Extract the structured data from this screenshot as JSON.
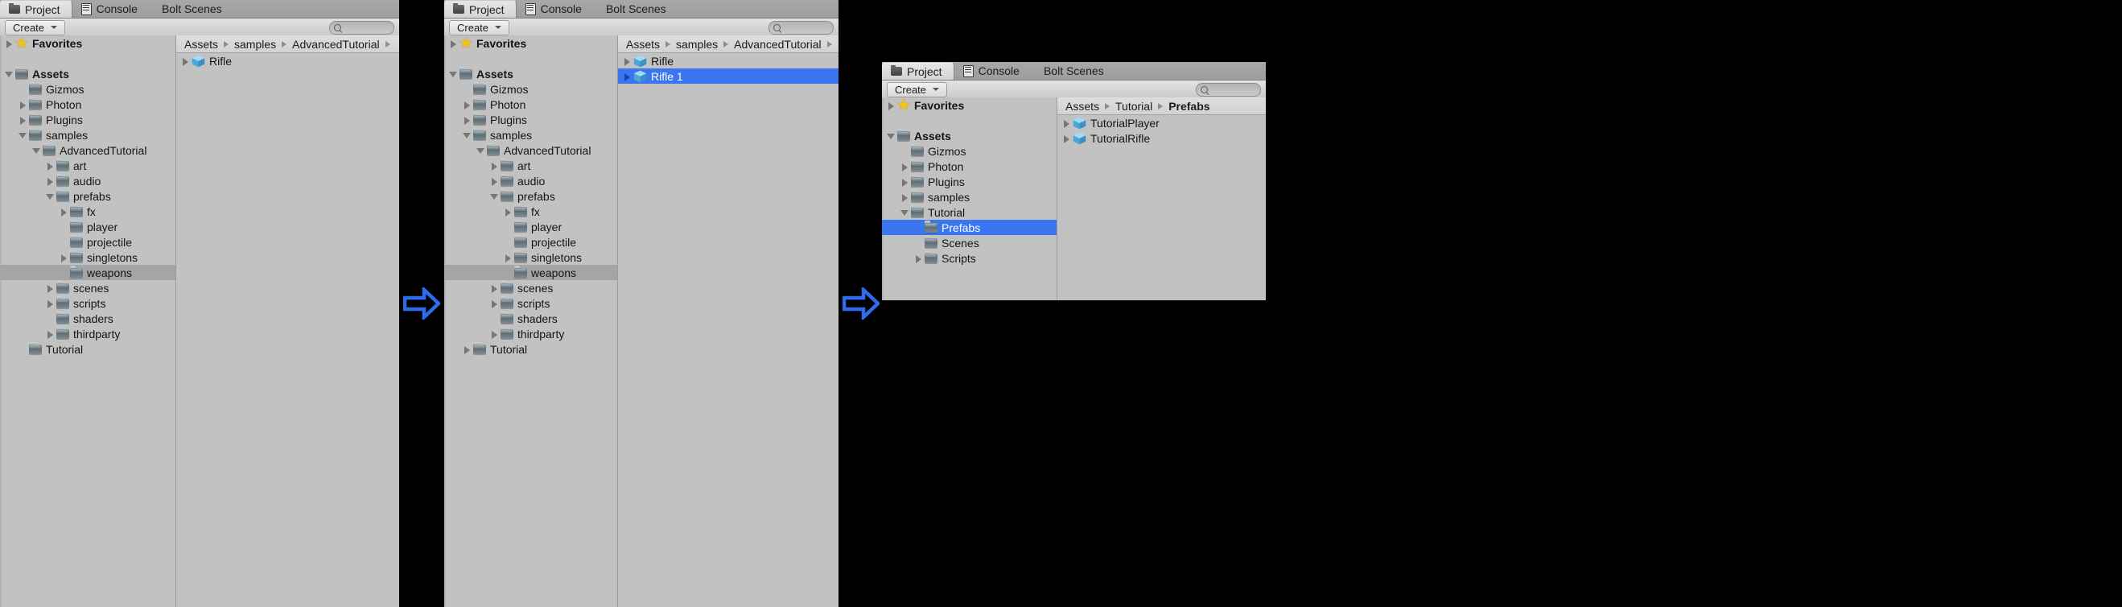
{
  "window": {
    "tabs": [
      {
        "label": "Project",
        "icon": "folder-icon",
        "active": true
      },
      {
        "label": "Console",
        "icon": "console-icon",
        "active": false
      },
      {
        "label": "Bolt Scenes",
        "icon": "",
        "active": false
      }
    ],
    "toolbar": {
      "create_label": "Create",
      "search_placeholder": "",
      "search_value": "",
      "search_icon": "search-icon"
    }
  },
  "panels": [
    {
      "id": "panel-1",
      "breadcrumb": [
        "Assets",
        "samples",
        "AdvancedTutorial",
        ""
      ],
      "tree": [
        {
          "label": "Favorites",
          "depth": 0,
          "twisty": "closed",
          "icon": "star-icon",
          "bold": true,
          "selected": "none"
        },
        {
          "label": "",
          "depth": 0,
          "twisty": "none",
          "icon": "none",
          "bold": false,
          "selected": "none"
        },
        {
          "label": "Assets",
          "depth": 0,
          "twisty": "open",
          "icon": "folder-icon",
          "bold": true,
          "selected": "none"
        },
        {
          "label": "Gizmos",
          "depth": 1,
          "twisty": "none",
          "icon": "folder-icon",
          "bold": false,
          "selected": "none"
        },
        {
          "label": "Photon",
          "depth": 1,
          "twisty": "closed",
          "icon": "folder-icon",
          "bold": false,
          "selected": "none"
        },
        {
          "label": "Plugins",
          "depth": 1,
          "twisty": "closed",
          "icon": "folder-icon",
          "bold": false,
          "selected": "none"
        },
        {
          "label": "samples",
          "depth": 1,
          "twisty": "open",
          "icon": "folder-icon",
          "bold": false,
          "selected": "none"
        },
        {
          "label": "AdvancedTutorial",
          "depth": 2,
          "twisty": "open",
          "icon": "folder-icon",
          "bold": false,
          "selected": "none"
        },
        {
          "label": "art",
          "depth": 3,
          "twisty": "closed",
          "icon": "folder-icon",
          "bold": false,
          "selected": "none"
        },
        {
          "label": "audio",
          "depth": 3,
          "twisty": "closed",
          "icon": "folder-icon",
          "bold": false,
          "selected": "none"
        },
        {
          "label": "prefabs",
          "depth": 3,
          "twisty": "open",
          "icon": "folder-icon",
          "bold": false,
          "selected": "none"
        },
        {
          "label": "fx",
          "depth": 4,
          "twisty": "closed",
          "icon": "folder-icon",
          "bold": false,
          "selected": "none"
        },
        {
          "label": "player",
          "depth": 4,
          "twisty": "none",
          "icon": "folder-icon",
          "bold": false,
          "selected": "none"
        },
        {
          "label": "projectile",
          "depth": 4,
          "twisty": "none",
          "icon": "folder-icon",
          "bold": false,
          "selected": "none"
        },
        {
          "label": "singletons",
          "depth": 4,
          "twisty": "closed",
          "icon": "folder-icon",
          "bold": false,
          "selected": "none"
        },
        {
          "label": "weapons",
          "depth": 4,
          "twisty": "none",
          "icon": "folder-icon",
          "bold": false,
          "selected": "gray"
        },
        {
          "label": "scenes",
          "depth": 3,
          "twisty": "closed",
          "icon": "folder-icon",
          "bold": false,
          "selected": "none"
        },
        {
          "label": "scripts",
          "depth": 3,
          "twisty": "closed",
          "icon": "folder-icon",
          "bold": false,
          "selected": "none"
        },
        {
          "label": "shaders",
          "depth": 3,
          "twisty": "none",
          "icon": "folder-icon",
          "bold": false,
          "selected": "none"
        },
        {
          "label": "thirdparty",
          "depth": 3,
          "twisty": "closed",
          "icon": "folder-icon",
          "bold": false,
          "selected": "none"
        },
        {
          "label": "Tutorial",
          "depth": 1,
          "twisty": "none",
          "icon": "folder-icon",
          "bold": false,
          "selected": "none"
        }
      ],
      "assets": [
        {
          "label": "Rifle",
          "icon": "prefab-cube-icon",
          "twisty": "closed",
          "selected": "none"
        }
      ]
    },
    {
      "id": "panel-2",
      "breadcrumb": [
        "Assets",
        "samples",
        "AdvancedTutorial",
        ""
      ],
      "tree": [
        {
          "label": "Favorites",
          "depth": 0,
          "twisty": "closed",
          "icon": "star-icon",
          "bold": true,
          "selected": "none"
        },
        {
          "label": "",
          "depth": 0,
          "twisty": "none",
          "icon": "none",
          "bold": false,
          "selected": "none"
        },
        {
          "label": "Assets",
          "depth": 0,
          "twisty": "open",
          "icon": "folder-icon",
          "bold": true,
          "selected": "none"
        },
        {
          "label": "Gizmos",
          "depth": 1,
          "twisty": "none",
          "icon": "folder-icon",
          "bold": false,
          "selected": "none"
        },
        {
          "label": "Photon",
          "depth": 1,
          "twisty": "closed",
          "icon": "folder-icon",
          "bold": false,
          "selected": "none"
        },
        {
          "label": "Plugins",
          "depth": 1,
          "twisty": "closed",
          "icon": "folder-icon",
          "bold": false,
          "selected": "none"
        },
        {
          "label": "samples",
          "depth": 1,
          "twisty": "open",
          "icon": "folder-icon",
          "bold": false,
          "selected": "none"
        },
        {
          "label": "AdvancedTutorial",
          "depth": 2,
          "twisty": "open",
          "icon": "folder-icon",
          "bold": false,
          "selected": "none"
        },
        {
          "label": "art",
          "depth": 3,
          "twisty": "closed",
          "icon": "folder-icon",
          "bold": false,
          "selected": "none"
        },
        {
          "label": "audio",
          "depth": 3,
          "twisty": "closed",
          "icon": "folder-icon",
          "bold": false,
          "selected": "none"
        },
        {
          "label": "prefabs",
          "depth": 3,
          "twisty": "open",
          "icon": "folder-icon",
          "bold": false,
          "selected": "none"
        },
        {
          "label": "fx",
          "depth": 4,
          "twisty": "closed",
          "icon": "folder-icon",
          "bold": false,
          "selected": "none"
        },
        {
          "label": "player",
          "depth": 4,
          "twisty": "none",
          "icon": "folder-icon",
          "bold": false,
          "selected": "none"
        },
        {
          "label": "projectile",
          "depth": 4,
          "twisty": "none",
          "icon": "folder-icon",
          "bold": false,
          "selected": "none"
        },
        {
          "label": "singletons",
          "depth": 4,
          "twisty": "closed",
          "icon": "folder-icon",
          "bold": false,
          "selected": "none"
        },
        {
          "label": "weapons",
          "depth": 4,
          "twisty": "none",
          "icon": "folder-icon",
          "bold": false,
          "selected": "gray"
        },
        {
          "label": "scenes",
          "depth": 3,
          "twisty": "closed",
          "icon": "folder-icon",
          "bold": false,
          "selected": "none"
        },
        {
          "label": "scripts",
          "depth": 3,
          "twisty": "closed",
          "icon": "folder-icon",
          "bold": false,
          "selected": "none"
        },
        {
          "label": "shaders",
          "depth": 3,
          "twisty": "none",
          "icon": "folder-icon",
          "bold": false,
          "selected": "none"
        },
        {
          "label": "thirdparty",
          "depth": 3,
          "twisty": "closed",
          "icon": "folder-icon",
          "bold": false,
          "selected": "none"
        },
        {
          "label": "Tutorial",
          "depth": 1,
          "twisty": "closed",
          "icon": "folder-icon",
          "bold": false,
          "selected": "none"
        }
      ],
      "assets": [
        {
          "label": "Rifle",
          "icon": "prefab-cube-icon",
          "twisty": "closed",
          "selected": "none"
        },
        {
          "label": "Rifle 1",
          "icon": "prefab-cube-icon",
          "twisty": "closed",
          "selected": "blue"
        }
      ]
    },
    {
      "id": "panel-3",
      "breadcrumb": [
        "Assets",
        "Tutorial",
        "Prefabs"
      ],
      "tree": [
        {
          "label": "Favorites",
          "depth": 0,
          "twisty": "closed",
          "icon": "star-icon",
          "bold": true,
          "selected": "none"
        },
        {
          "label": "",
          "depth": 0,
          "twisty": "none",
          "icon": "none",
          "bold": false,
          "selected": "none"
        },
        {
          "label": "Assets",
          "depth": 0,
          "twisty": "open",
          "icon": "folder-icon",
          "bold": true,
          "selected": "none"
        },
        {
          "label": "Gizmos",
          "depth": 1,
          "twisty": "none",
          "icon": "folder-icon",
          "bold": false,
          "selected": "none"
        },
        {
          "label": "Photon",
          "depth": 1,
          "twisty": "closed",
          "icon": "folder-icon",
          "bold": false,
          "selected": "none"
        },
        {
          "label": "Plugins",
          "depth": 1,
          "twisty": "closed",
          "icon": "folder-icon",
          "bold": false,
          "selected": "none"
        },
        {
          "label": "samples",
          "depth": 1,
          "twisty": "closed",
          "icon": "folder-icon",
          "bold": false,
          "selected": "none"
        },
        {
          "label": "Tutorial",
          "depth": 1,
          "twisty": "open",
          "icon": "folder-icon",
          "bold": false,
          "selected": "none"
        },
        {
          "label": "Prefabs",
          "depth": 2,
          "twisty": "none",
          "icon": "folder-icon",
          "bold": false,
          "selected": "blue"
        },
        {
          "label": "Scenes",
          "depth": 2,
          "twisty": "none",
          "icon": "folder-icon",
          "bold": false,
          "selected": "none"
        },
        {
          "label": "Scripts",
          "depth": 2,
          "twisty": "closed",
          "icon": "folder-icon",
          "bold": false,
          "selected": "none"
        }
      ],
      "assets": [
        {
          "label": "TutorialPlayer",
          "icon": "prefab-cube-icon",
          "twisty": "closed",
          "selected": "none"
        },
        {
          "label": "TutorialRifle",
          "icon": "prefab-cube-icon",
          "twisty": "closed",
          "selected": "none"
        }
      ]
    }
  ],
  "arrows": [
    {
      "name": "transition-arrow-1",
      "direction": "right",
      "color": "#2f6bed"
    },
    {
      "name": "transition-arrow-2",
      "direction": "right",
      "color": "#2f6bed"
    }
  ],
  "colors": {
    "selection_blue": "#3a76f0",
    "selection_gray": "#a5a5a5",
    "panel_bg": "#c2c2c2",
    "arrow_blue": "#2f6bed",
    "background": "#000000"
  }
}
